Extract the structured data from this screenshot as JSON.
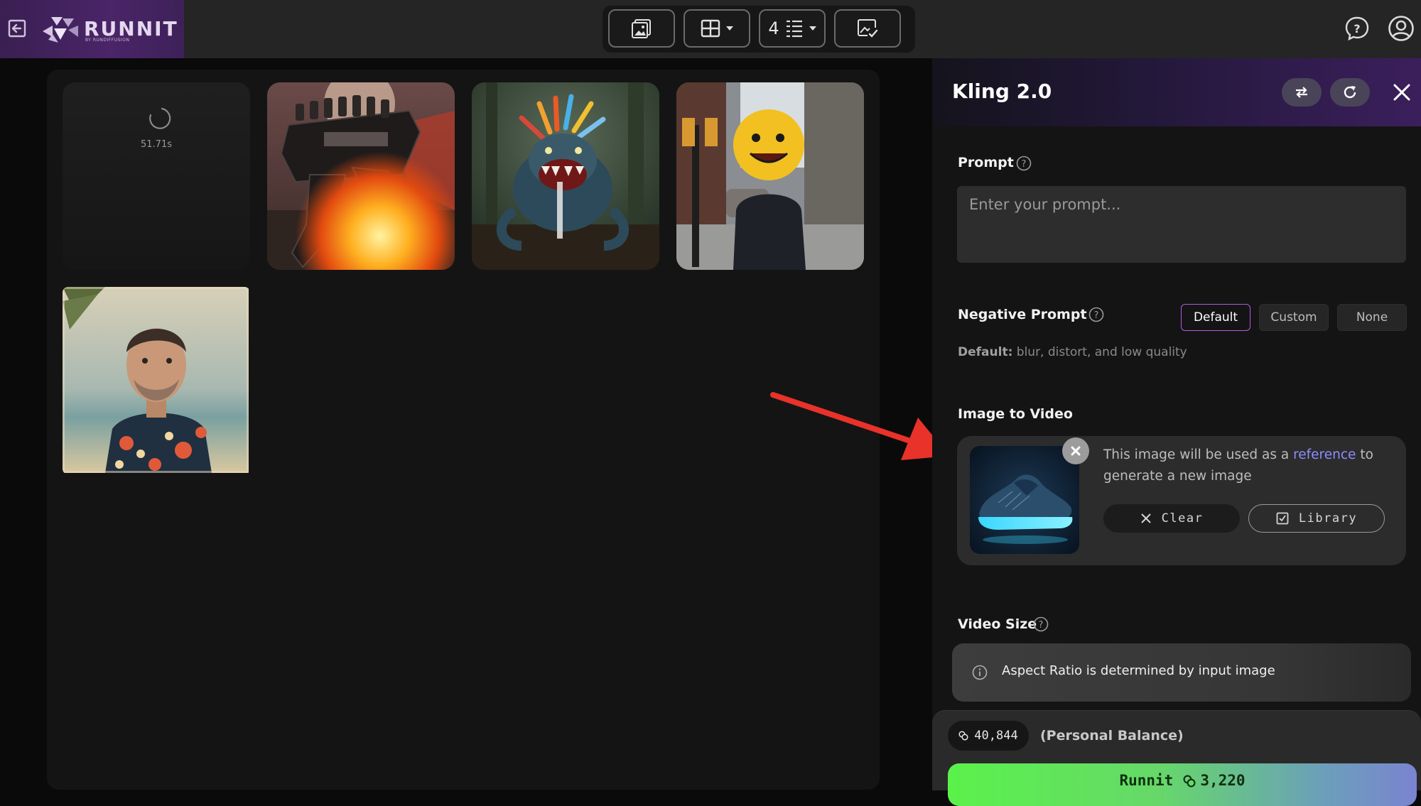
{
  "brand": {
    "name": "RUNNIT",
    "tagline": "BY RUNDIFFUSION"
  },
  "toolbar": {
    "images_per_run": "4"
  },
  "gallery": {
    "pending_timer": "51.71s"
  },
  "panel": {
    "title": "Kling 2.0",
    "prompt": {
      "label": "Prompt",
      "placeholder": "Enter your prompt..."
    },
    "negative_prompt": {
      "label": "Negative Prompt",
      "options": [
        "Default",
        "Custom",
        "None"
      ],
      "selected": "Default",
      "note_label": "Default:",
      "note_value": "blur, distort, and low quality"
    },
    "image_to_video": {
      "label": "Image to Video",
      "text_before": "This image will be used as a",
      "text_link": "reference",
      "text_after": "to generate a new image",
      "clear_label": "Clear",
      "library_label": "Library"
    },
    "video_size": {
      "label": "Video Size",
      "info": "Aspect Ratio is determined by input image"
    },
    "footer": {
      "balance": "40,844",
      "balance_label": "(Personal Balance)",
      "run_label": "Runnit",
      "run_cost": "3,220"
    }
  },
  "colors": {
    "accent_purple": "#b35ae6",
    "run_green": "#5af24a",
    "link_blue": "#8f8cff",
    "arrow_red": "#e8322a"
  }
}
